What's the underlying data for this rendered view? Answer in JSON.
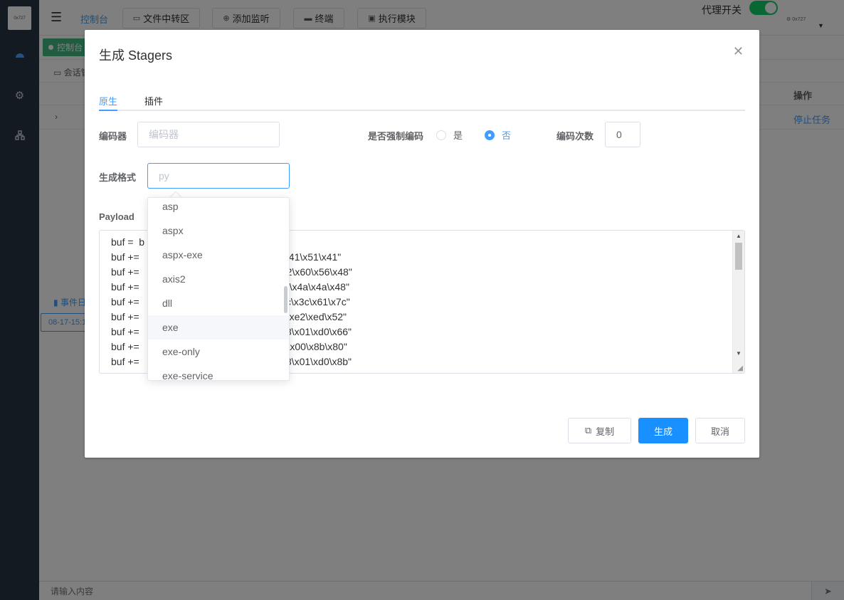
{
  "app": {
    "logo_text": "0x727",
    "breadcrumb": "控制台",
    "toolbar": [
      {
        "icon": "folder-icon",
        "label": "文件中转区"
      },
      {
        "icon": "plus-circle-icon",
        "label": "添加监听"
      },
      {
        "icon": "terminal-icon",
        "label": "终端"
      },
      {
        "icon": "box-icon",
        "label": "执行模块"
      }
    ],
    "proxy_label": "代理开关",
    "proxy_on": true,
    "username": "0x727",
    "active_tab": "控制台",
    "session_label": "会话管理",
    "table_op_header": "操作",
    "row_action": "停止任务",
    "event_label": "事件日志",
    "event_date": "08-17-15:1",
    "command_placeholder": "请输入内容"
  },
  "dialog": {
    "title": "生成 Stagers",
    "tabs": [
      "原生",
      "插件"
    ],
    "active_tab": 0,
    "encoder_label": "编码器",
    "encoder_placeholder": "编码器",
    "force_encode_label": "是否强制编码",
    "force_yes": "是",
    "force_no": "否",
    "force_selected": "否",
    "encode_count_label": "编码次数",
    "encode_count_value": "0",
    "format_label": "生成格式",
    "format_placeholder": "py",
    "payload_label": "Payload",
    "payload_lines": [
      "buf =  b",
      "buf +=                             c\\x00\\x00\\x00\\x41\\x51\\x41\"",
      "buf +=                             x65\\x48\\x8b\\x52\\x60\\x56\\x48\"",
      "buf +=                             x20\\x48\\x0f\\xb7\\x4a\\x4a\\x48\"",
      "buf +=                             x48\\x31\\xc0\\xac\\x3c\\x61\\x7c\"",
      "buf +=                             0d\\x41\\x01\\xc1\\xe2\\xed\\x52\"",
      "buf +=                             x8b\\x42\\x3c\\x48\\x01\\xd0\\x66\"",
      "buf +=                             85\\x72\\x00\\x00\\x00\\x8b\\x80\"",
      "buf +=                             xc0\\x74\\x67\\x48\\x01\\xd0\\x8b\""
    ],
    "format_options": [
      "asp",
      "aspx",
      "aspx-exe",
      "axis2",
      "dll",
      "exe",
      "exe-only",
      "exe-service"
    ],
    "hovered_option": "exe",
    "buttons": {
      "copy": "复制",
      "generate": "生成",
      "cancel": "取消"
    }
  },
  "colors": {
    "primary": "#1890ff",
    "accent": "#409eff",
    "toggle": "#13ce66",
    "sidebar": "#263445"
  }
}
